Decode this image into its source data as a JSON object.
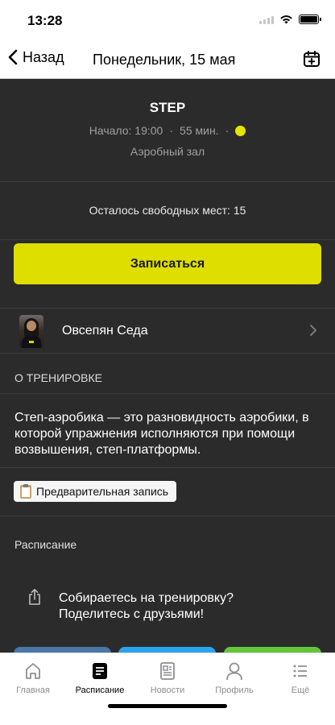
{
  "status_bar": {
    "time": "13:28"
  },
  "nav": {
    "back_label": "Назад",
    "title": "Понедельник, 15 мая"
  },
  "class_info": {
    "name": "STEP",
    "start": "Начало: 19:00",
    "separator": "·",
    "duration": "55 мин.",
    "hall": "Аэробный зал",
    "dot_color": "#e4e400"
  },
  "seats": {
    "text": "Осталось свободных мест: 15"
  },
  "signup": {
    "label": "Записаться",
    "color": "#dede00"
  },
  "trainer": {
    "name": "Овсепян Седа"
  },
  "about": {
    "title": "О ТРЕНИРОВКЕ",
    "description": "Степ-аэробика — это разновидность аэробики, в которой упражнения исполняются при помощи возвышения, степ-платформы."
  },
  "badge": {
    "label": "Предварительная запись"
  },
  "schedule": {
    "label": "Расписание"
  },
  "share": {
    "line1": "Собираетесь на тренировку?",
    "line2": "Поделитесь с друзьями!"
  },
  "social_colors": [
    "#4a76a8",
    "#2aa3ef",
    "#62c63a"
  ],
  "tabs": [
    {
      "label": "Главная",
      "icon": "home-icon",
      "active": false
    },
    {
      "label": "Расписание",
      "icon": "schedule-icon",
      "active": true
    },
    {
      "label": "Новости",
      "icon": "news-icon",
      "active": false
    },
    {
      "label": "Профиль",
      "icon": "profile-icon",
      "active": false
    },
    {
      "label": "Ещё",
      "icon": "more-icon",
      "active": false
    }
  ]
}
